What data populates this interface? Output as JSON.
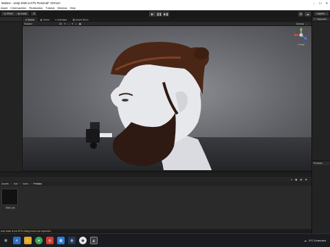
{
  "window": {
    "title": "Malone - Unity 2020.3.47f1 Personal* <DX12>"
  },
  "menu": {
    "items": [
      "Asset",
      "Cinemachine",
      "Realization",
      "Tutorial",
      "Window",
      "Help"
    ]
  },
  "toolbar": {
    "pivot": "Pivot",
    "local": "Local",
    "layers": "Layers",
    "layout": "Layout"
  },
  "tabs": {
    "scene": "Scene",
    "game": "Game",
    "animator": "Animator",
    "asset_store": "Asset Store"
  },
  "scene": {
    "shading": "Shaded",
    "view_mode": "2D",
    "gizmos": "Gizmos",
    "persp": "< Persp"
  },
  "right": {
    "inspector": "Inspector",
    "preview": "Preview"
  },
  "project": {
    "breadcrumbs": [
      "Assets",
      "hair",
      "hair4",
      "Prefabs"
    ],
    "asset_label": "Male_hai"
  },
  "status": {
    "message": "ever state is not GPU hitting errors are expected."
  },
  "taskbar": {
    "weather": "5°C  Extended"
  }
}
